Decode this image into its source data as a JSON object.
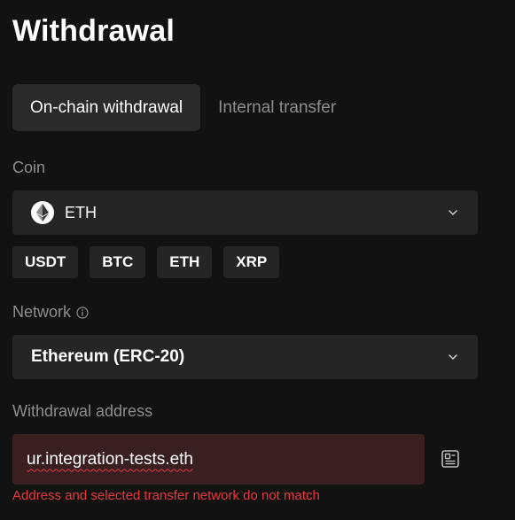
{
  "page": {
    "title": "Withdrawal"
  },
  "tabs": [
    {
      "label": "On-chain withdrawal",
      "active": true
    },
    {
      "label": "Internal transfer",
      "active": false
    }
  ],
  "coin": {
    "label": "Coin",
    "selected": "ETH",
    "selected_icon": "ethereum-icon",
    "quick_picks": [
      "USDT",
      "BTC",
      "ETH",
      "XRP"
    ]
  },
  "network": {
    "label": "Network",
    "info_icon": "info-icon",
    "selected": "Ethereum (ERC-20)"
  },
  "address": {
    "label": "Withdrawal address",
    "value": "ur.integration-tests.eth",
    "book_icon": "address-book-icon",
    "error": "Address and selected transfer network do not match"
  },
  "colors": {
    "background": "#121212",
    "panel": "#252525",
    "active_tab": "#2a2a2a",
    "muted_text": "#8d8d8d",
    "error_text": "#e8393f",
    "error_field": "#3a1f21"
  }
}
